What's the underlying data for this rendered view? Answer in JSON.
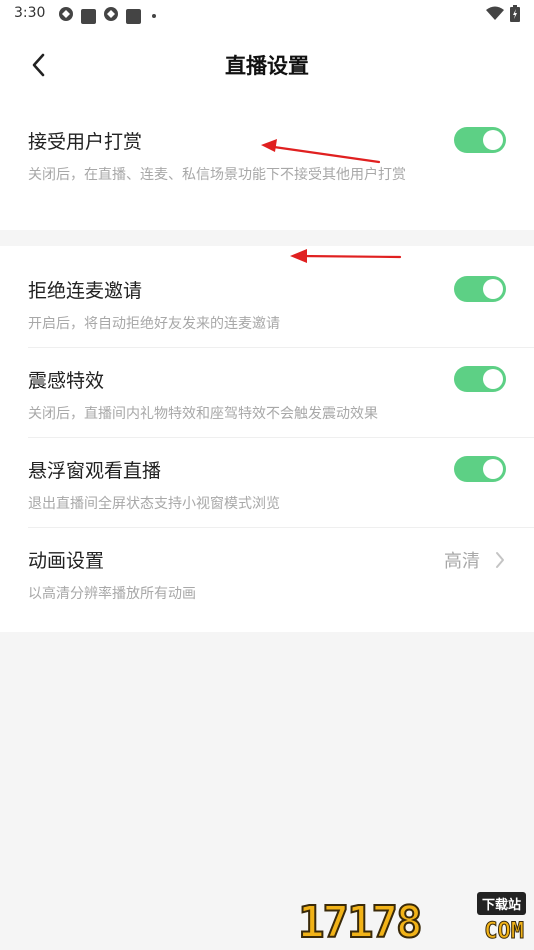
{
  "status": {
    "time": "3:30"
  },
  "header": {
    "title": "直播设置"
  },
  "rows": [
    {
      "label": "接受用户打赏",
      "desc": "关闭后，在直播、连麦、私信场景功能下不接受其他用户打赏",
      "toggle_on": true
    },
    {
      "label": "拒绝连麦邀请",
      "desc": "开启后，将自动拒绝好友发来的连麦邀请",
      "toggle_on": true
    },
    {
      "label": "震感特效",
      "desc": "关闭后，直播间内礼物特效和座驾特效不会触发震动效果",
      "toggle_on": true
    },
    {
      "label": "悬浮窗观看直播",
      "desc": "退出直播间全屏状态支持小视窗模式浏览",
      "toggle_on": true
    },
    {
      "label": "动画设置",
      "desc": "以高清分辨率播放所有动画",
      "value": "高清"
    }
  ],
  "watermark": {
    "number": "17178",
    "tag": "下载站",
    "domain": "COM"
  },
  "colors": {
    "toggle_on": "#5dd085",
    "annotation_arrow": "#e02020",
    "watermark": "#f2b318"
  }
}
